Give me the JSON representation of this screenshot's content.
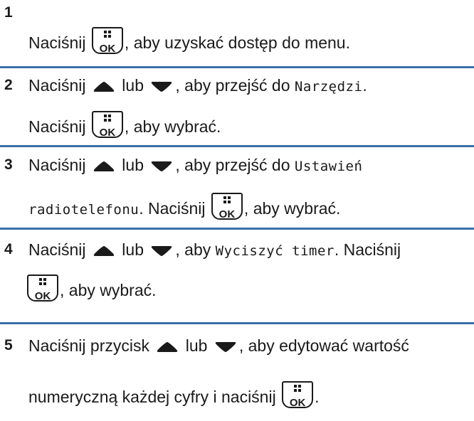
{
  "steps": [
    {
      "number": "1",
      "lines": [
        [
          {
            "t": "Naciśnij "
          },
          {
            "icon": "ok"
          },
          {
            "t": ", aby uzyskać dostęp do menu."
          }
        ]
      ]
    },
    {
      "number": "2",
      "lines": [
        [
          {
            "t": "Naciśnij "
          },
          {
            "icon": "up"
          },
          {
            "t": " lub "
          },
          {
            "icon": "down"
          },
          {
            "t": ", aby przejść do "
          },
          {
            "m": "Narzędzi"
          },
          {
            "t": "."
          }
        ],
        [
          {
            "t": "Naciśnij "
          },
          {
            "icon": "ok"
          },
          {
            "t": ", aby wybrać."
          }
        ]
      ]
    },
    {
      "number": "3",
      "lines": [
        [
          {
            "t": "Naciśnij "
          },
          {
            "icon": "up"
          },
          {
            "t": " lub "
          },
          {
            "icon": "down"
          },
          {
            "t": ", aby przejść do "
          },
          {
            "m": "Ustawień"
          }
        ],
        [
          {
            "m": "radiotelefonu"
          },
          {
            "t": ". Naciśnij "
          },
          {
            "icon": "ok"
          },
          {
            "t": ", aby wybrać."
          }
        ]
      ]
    },
    {
      "number": "4",
      "lines": [
        [
          {
            "t": "Naciśnij "
          },
          {
            "icon": "up"
          },
          {
            "t": " lub "
          },
          {
            "icon": "down"
          },
          {
            "t": ", aby "
          },
          {
            "m": "Wyciszyć timer"
          },
          {
            "t": ". Naciśnij"
          }
        ],
        [
          {
            "icon": "ok"
          },
          {
            "t": ", aby wybrać."
          }
        ]
      ]
    },
    {
      "number": "5",
      "lines": [
        [
          {
            "t": "Naciśnij przycisk "
          },
          {
            "icon": "up"
          },
          {
            "t": " lub "
          },
          {
            "icon": "down"
          },
          {
            "t": ", aby edytować wartość"
          }
        ],
        [
          {
            "t": "numeryczną każdej cyfry i naciśnij "
          },
          {
            "icon": "ok"
          },
          {
            "t": "."
          }
        ]
      ]
    }
  ],
  "ok_label": "OK",
  "colors": {
    "divider": "#3a6fa8",
    "text": "#1a1a1a"
  }
}
